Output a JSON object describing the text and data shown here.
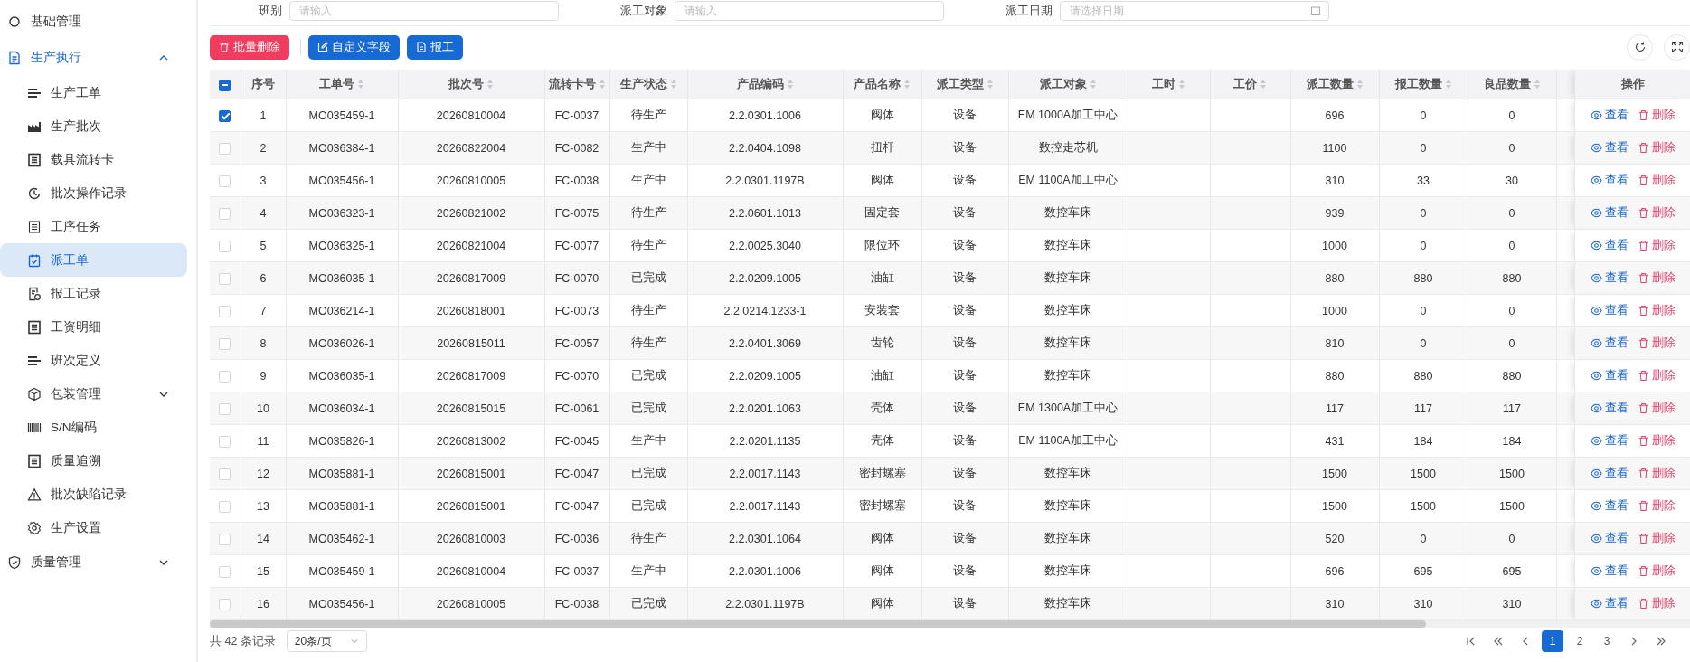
{
  "sidebar": {
    "items": [
      {
        "label": "基础管理",
        "selected": false
      },
      {
        "label": "生产执行",
        "selected": false,
        "expanded": true,
        "children": [
          {
            "label": "生产工单",
            "selected": false
          },
          {
            "label": "生产批次",
            "selected": false
          },
          {
            "label": "载具流转卡",
            "selected": false
          },
          {
            "label": "批次操作记录",
            "selected": false
          },
          {
            "label": "工序任务",
            "selected": false
          },
          {
            "label": "派工单",
            "selected": true
          },
          {
            "label": "报工记录",
            "selected": false
          },
          {
            "label": "工资明细",
            "selected": false
          },
          {
            "label": "班次定义",
            "selected": false
          },
          {
            "label": "包装管理",
            "selected": false,
            "expanded": false
          },
          {
            "label": "S/N编码",
            "selected": false
          },
          {
            "label": "质量追溯",
            "selected": false
          },
          {
            "label": "批次缺陷记录",
            "selected": false
          },
          {
            "label": "生产设置",
            "selected": false
          }
        ]
      },
      {
        "label": "质量管理",
        "selected": false,
        "expanded": false
      }
    ]
  },
  "filters": [
    {
      "label": "班别",
      "placeholder": "请输入",
      "kind": "text"
    },
    {
      "label": "派工对象",
      "placeholder": "请输入",
      "kind": "text"
    },
    {
      "label": "派工日期",
      "placeholder": "请选择日期",
      "kind": "date"
    }
  ],
  "toolbar": {
    "buttons": [
      {
        "label": "批量删除",
        "kind": "danger"
      },
      {
        "label": "自定义字段",
        "kind": "edit"
      },
      {
        "label": "报工",
        "kind": "report"
      }
    ]
  },
  "table": {
    "select_all": {
      "indeterminate": true
    },
    "columns": [
      {
        "label": "序号",
        "sortable": false
      },
      {
        "label": "工单号",
        "sortable": true
      },
      {
        "label": "批次号",
        "sortable": true
      },
      {
        "label": "流转卡号",
        "sortable": true
      },
      {
        "label": "生产状态",
        "sortable": true
      },
      {
        "label": "产品编码",
        "sortable": true
      },
      {
        "label": "产品名称",
        "sortable": true
      },
      {
        "label": "派工类型",
        "sortable": true
      },
      {
        "label": "派工对象",
        "sortable": true
      },
      {
        "label": "工时",
        "sortable": true
      },
      {
        "label": "工价",
        "sortable": true
      },
      {
        "label": "派工数量",
        "sortable": true
      },
      {
        "label": "报工数量",
        "sortable": true
      },
      {
        "label": "良品数量",
        "sortable": true
      }
    ],
    "actions_label": "操作",
    "rows": [
      {
        "checked": true,
        "index": "1",
        "order_no": "MO035459-1",
        "batch_no": "20260810004",
        "card_no": "FC-0037",
        "status": "待生产",
        "product_code": "2.2.0301.1006",
        "product_name": "阀体",
        "dispatch_type": "设备",
        "dispatch_target": "EM 1000A加工中心",
        "dispatch_qty": "696",
        "report_qty": "0",
        "good_qty": "0",
        "view": "查看",
        "delete": "删除"
      },
      {
        "checked": false,
        "index": "2",
        "order_no": "MO036384-1",
        "batch_no": "20260822004",
        "card_no": "FC-0082",
        "status": "生产中",
        "product_code": "2.2.0404.1098",
        "product_name": "扭杆",
        "dispatch_type": "设备",
        "dispatch_target": "数控走芯机",
        "dispatch_qty": "1100",
        "report_qty": "0",
        "good_qty": "0",
        "view": "查看",
        "delete": "删除"
      },
      {
        "checked": false,
        "index": "3",
        "order_no": "MO035456-1",
        "batch_no": "20260810005",
        "card_no": "FC-0038",
        "status": "生产中",
        "product_code": "2.2.0301.1197B",
        "product_name": "阀体",
        "dispatch_type": "设备",
        "dispatch_target": "EM 1100A加工中心",
        "dispatch_qty": "310",
        "report_qty": "33",
        "good_qty": "30",
        "view": "查看",
        "delete": "删除"
      },
      {
        "checked": false,
        "index": "4",
        "order_no": "MO036323-1",
        "batch_no": "20260821002",
        "card_no": "FC-0075",
        "status": "待生产",
        "product_code": "2.2.0601.1013",
        "product_name": "固定套",
        "dispatch_type": "设备",
        "dispatch_target": "数控车床",
        "dispatch_qty": "939",
        "report_qty": "0",
        "good_qty": "0",
        "view": "查看",
        "delete": "删除"
      },
      {
        "checked": false,
        "index": "5",
        "order_no": "MO036325-1",
        "batch_no": "20260821004",
        "card_no": "FC-0077",
        "status": "待生产",
        "product_code": "2.2.0025.3040",
        "product_name": "限位环",
        "dispatch_type": "设备",
        "dispatch_target": "数控车床",
        "dispatch_qty": "1000",
        "report_qty": "0",
        "good_qty": "0",
        "view": "查看",
        "delete": "删除"
      },
      {
        "checked": false,
        "index": "6",
        "order_no": "MO036035-1",
        "batch_no": "20260817009",
        "card_no": "FC-0070",
        "status": "已完成",
        "product_code": "2.2.0209.1005",
        "product_name": "油缸",
        "dispatch_type": "设备",
        "dispatch_target": "数控车床",
        "dispatch_qty": "880",
        "report_qty": "880",
        "good_qty": "880",
        "view": "查看",
        "delete": "删除"
      },
      {
        "checked": false,
        "index": "7",
        "order_no": "MO036214-1",
        "batch_no": "20260818001",
        "card_no": "FC-0073",
        "status": "待生产",
        "product_code": "2.2.0214.1233-1",
        "product_name": "安装套",
        "dispatch_type": "设备",
        "dispatch_target": "数控车床",
        "dispatch_qty": "1000",
        "report_qty": "0",
        "good_qty": "0",
        "view": "查看",
        "delete": "删除"
      },
      {
        "checked": false,
        "index": "8",
        "order_no": "MO036026-1",
        "batch_no": "20260815011",
        "card_no": "FC-0057",
        "status": "待生产",
        "product_code": "2.2.0401.3069",
        "product_name": "齿轮",
        "dispatch_type": "设备",
        "dispatch_target": "数控车床",
        "dispatch_qty": "810",
        "report_qty": "0",
        "good_qty": "0",
        "view": "查看",
        "delete": "删除"
      },
      {
        "checked": false,
        "index": "9",
        "order_no": "MO036035-1",
        "batch_no": "20260817009",
        "card_no": "FC-0070",
        "status": "已完成",
        "product_code": "2.2.0209.1005",
        "product_name": "油缸",
        "dispatch_type": "设备",
        "dispatch_target": "数控车床",
        "dispatch_qty": "880",
        "report_qty": "880",
        "good_qty": "880",
        "view": "查看",
        "delete": "删除"
      },
      {
        "checked": false,
        "index": "10",
        "order_no": "MO036034-1",
        "batch_no": "20260815015",
        "card_no": "FC-0061",
        "status": "已完成",
        "product_code": "2.2.0201.1063",
        "product_name": "壳体",
        "dispatch_type": "设备",
        "dispatch_target": "EM 1300A加工中心",
        "dispatch_qty": "117",
        "report_qty": "117",
        "good_qty": "117",
        "view": "查看",
        "delete": "删除"
      },
      {
        "checked": false,
        "index": "11",
        "order_no": "MO035826-1",
        "batch_no": "20260813002",
        "card_no": "FC-0045",
        "status": "生产中",
        "product_code": "2.2.0201.1135",
        "product_name": "壳体",
        "dispatch_type": "设备",
        "dispatch_target": "EM 1100A加工中心",
        "dispatch_qty": "431",
        "report_qty": "184",
        "good_qty": "184",
        "view": "查看",
        "delete": "删除"
      },
      {
        "checked": false,
        "index": "12",
        "order_no": "MO035881-1",
        "batch_no": "20260815001",
        "card_no": "FC-0047",
        "status": "已完成",
        "product_code": "2.2.0017.1143",
        "product_name": "密封螺塞",
        "dispatch_type": "设备",
        "dispatch_target": "数控车床",
        "dispatch_qty": "1500",
        "report_qty": "1500",
        "good_qty": "1500",
        "view": "查看",
        "delete": "删除"
      },
      {
        "checked": false,
        "index": "13",
        "order_no": "MO035881-1",
        "batch_no": "20260815001",
        "card_no": "FC-0047",
        "status": "已完成",
        "product_code": "2.2.0017.1143",
        "product_name": "密封螺塞",
        "dispatch_type": "设备",
        "dispatch_target": "数控车床",
        "dispatch_qty": "1500",
        "report_qty": "1500",
        "good_qty": "1500",
        "view": "查看",
        "delete": "删除"
      },
      {
        "checked": false,
        "index": "14",
        "order_no": "MO035462-1",
        "batch_no": "20260810003",
        "card_no": "FC-0036",
        "status": "待生产",
        "product_code": "2.2.0301.1064",
        "product_name": "阀体",
        "dispatch_type": "设备",
        "dispatch_target": "数控车床",
        "dispatch_qty": "520",
        "report_qty": "0",
        "good_qty": "0",
        "view": "查看",
        "delete": "删除"
      },
      {
        "checked": false,
        "index": "15",
        "order_no": "MO035459-1",
        "batch_no": "20260810004",
        "card_no": "FC-0037",
        "status": "生产中",
        "product_code": "2.2.0301.1006",
        "product_name": "阀体",
        "dispatch_type": "设备",
        "dispatch_target": "数控车床",
        "dispatch_qty": "696",
        "report_qty": "695",
        "good_qty": "695",
        "view": "查看",
        "delete": "删除"
      },
      {
        "checked": false,
        "index": "16",
        "order_no": "MO035456-1",
        "batch_no": "20260810005",
        "card_no": "FC-0038",
        "status": "已完成",
        "product_code": "2.2.0301.1197B",
        "product_name": "阀体",
        "dispatch_type": "设备",
        "dispatch_target": "数控车床",
        "dispatch_qty": "310",
        "report_qty": "310",
        "good_qty": "310",
        "view": "查看",
        "delete": "删除"
      }
    ]
  },
  "pagination": {
    "total": "共 42 条记录",
    "page_size": "20条/页",
    "pages": [
      {
        "label": "1",
        "selected": true
      },
      {
        "label": "2",
        "selected": false
      },
      {
        "label": "3",
        "selected": false
      }
    ]
  }
}
